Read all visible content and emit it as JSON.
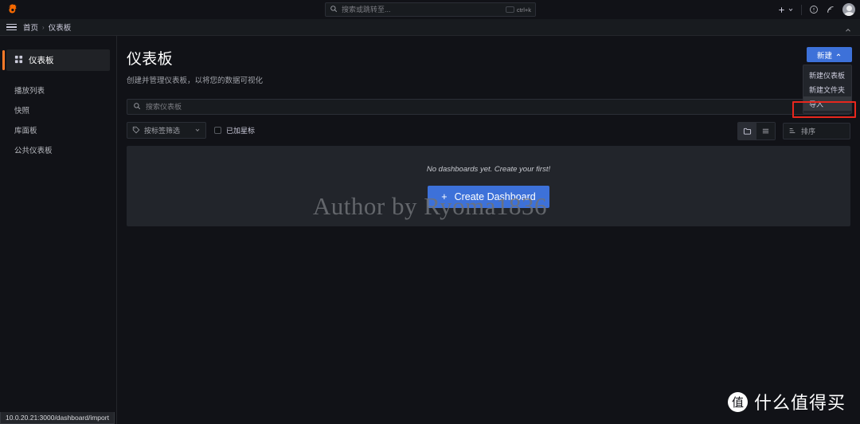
{
  "topbar": {
    "logo_icon": "grafana-logo-icon",
    "search": {
      "placeholder": "搜索或跳转至...",
      "value": "",
      "icon": "search-icon",
      "shortcut": "ctrl+k"
    },
    "actions": {
      "plus_label": "+",
      "plus_chevron": "⌄",
      "help_icon": "help-circle-icon",
      "news_icon": "news-rss-icon",
      "avatar_icon": "user-avatar"
    }
  },
  "breadcrumb": {
    "menu_icon": "hamburger-menu-icon",
    "home": "首页",
    "separator": "›",
    "current": "仪表板",
    "collapse_icon": "chevron-up-icon"
  },
  "sidebar": {
    "active": {
      "label": "仪表板",
      "icon": "apps-grid-icon"
    },
    "items": [
      {
        "label": "播放列表"
      },
      {
        "label": "快照"
      },
      {
        "label": "库面板"
      },
      {
        "label": "公共仪表板"
      }
    ]
  },
  "page": {
    "title": "仪表板",
    "subtitle": "创建并管理仪表板，以将您的数据可视化"
  },
  "new_menu": {
    "button_label": "新建",
    "button_chevron": "⌃",
    "items": [
      {
        "label": "新建仪表板",
        "highlighted": false
      },
      {
        "label": "新建文件夹",
        "highlighted": false
      },
      {
        "label": "导入",
        "highlighted": true
      }
    ]
  },
  "toolbar": {
    "search": {
      "placeholder": "搜索仪表板",
      "value": "",
      "icon": "search-icon"
    },
    "tag_filter": {
      "label": "按标签筛选",
      "icon": "tag-icon",
      "chevron": "⌄"
    },
    "starred": {
      "label": "已加星标",
      "checked": false
    },
    "view_folder_icon": "folder-view-icon",
    "view_list_icon": "list-view-icon",
    "sort": {
      "label": "排序",
      "icon": "sort-icon"
    }
  },
  "empty_state": {
    "message": "No dashboards yet. Create your first!",
    "button_label": "Create Dashboard",
    "button_plus": "+"
  },
  "watermarks": {
    "author": "Author by Ryoma1836",
    "smzdm_logo": "值",
    "smzdm_text": "什么值得买"
  },
  "status_url": "10.0.20.21:3000/dashboard/import",
  "colors": {
    "accent_blue": "#3d71d9",
    "accent_orange": "#ff7a29",
    "annotation_red": "#e8271d",
    "panel_bg": "#22252b",
    "app_bg": "#111217"
  }
}
